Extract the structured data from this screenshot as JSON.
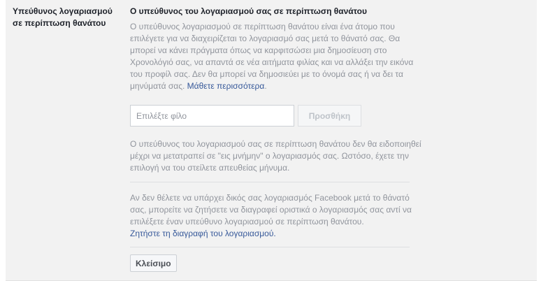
{
  "section": {
    "label": "Υπεύθυνος λογαριασμού σε περίπτωση θανάτου"
  },
  "legacy": {
    "title": "Ο υπεύθυνος του λογαριασμού σας σε περίπτωση θανάτου",
    "description": "Ο υπεύθυνος λογαριασμού σε περίπτωση θανάτου είναι ένα άτομο που επιλέγετε για να διαχειρίζεται το λογαριασμό σας μετά το θάνατό σας. Θα μπορεί να κάνει πράγματα όπως να καρφιτσώσει μια δημοσίευση στο Χρονολόγιό σας, να απαντά σε νέα αιτήματα φιλίας και να αλλάξει την εικόνα του προφίλ σας. Δεν θα μπορεί να δημοσιεύει με το όνομά σας ή να δει τα μηνύματά σας. ",
    "learn_more": "Μάθετε περισσότερα",
    "period": ".",
    "friend_input_placeholder": "Επιλέξτε φίλο",
    "friend_input_value": "",
    "add_button": "Προσθήκη",
    "notify_text": "Ο υπεύθυνος του λογαριασμού σας σε περίπτωση θανάτου δεν θα ειδοποιηθεί μέχρι να μετατραπεί σε \"εις μνήμην\" ο λογαριασμός σας. Ωστόσο, έχετε την επιλογή να του στείλετε απευθείας μήνυμα.",
    "delete_text": "Αν δεν θέλετε να υπάρχει δικός σας λογαριασμός Facebook μετά το θάνατό σας, μπορείτε να ζητήσετε να διαγραφεί οριστικά ο λογαριασμός σας αντί να επιλέξετε έναν υπεύθυνο λογαριασμού σε περίπτωση θανάτου.",
    "delete_link": "Ζητήστε τη διαγραφή του λογαριασμού.",
    "close_button": "Κλείσιμο"
  },
  "colors": {
    "panel_bg": "#f2f2f2",
    "muted_text": "#90949c",
    "link": "#365899"
  }
}
